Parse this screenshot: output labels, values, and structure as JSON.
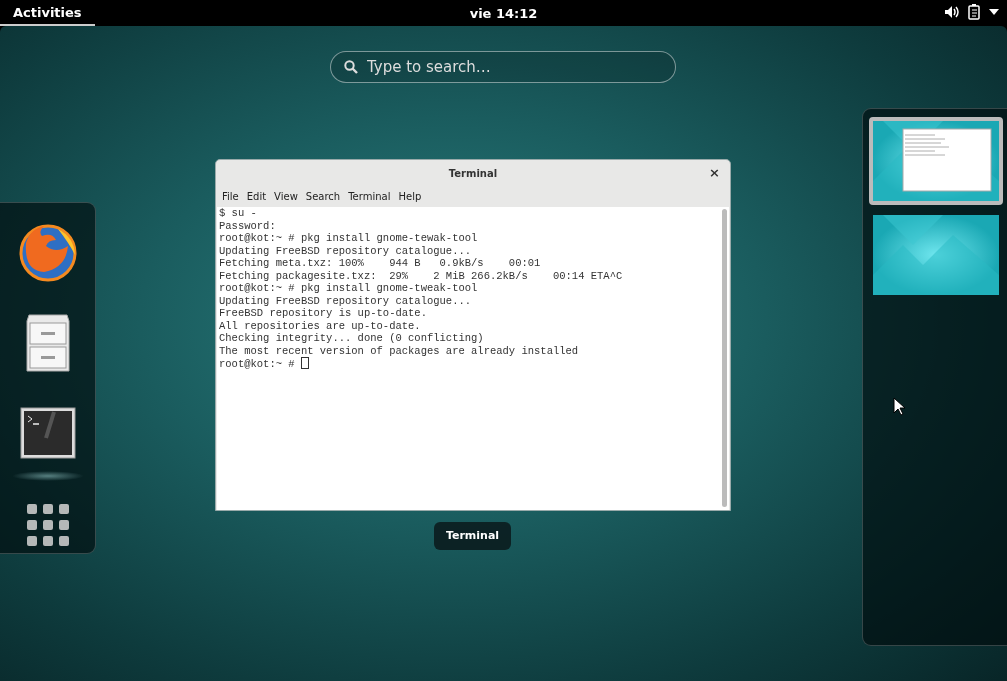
{
  "top_bar": {
    "activities": "Activities",
    "clock": "vie 14:12"
  },
  "search": {
    "placeholder": "Type to search…"
  },
  "dock": {
    "items": [
      {
        "kind": "browser",
        "running": false
      },
      {
        "kind": "files",
        "running": false
      },
      {
        "kind": "terminal",
        "running": true
      },
      {
        "kind": "app-grid"
      }
    ]
  },
  "window": {
    "title": "Terminal",
    "close": "×",
    "menu": [
      "File",
      "Edit",
      "View",
      "Search",
      "Terminal",
      "Help"
    ],
    "lines": [
      "$ su -",
      "Password:",
      "root@kot:~ # pkg install gnome-tewak-tool",
      "Updating FreeBSD repository catalogue...",
      "Fetching meta.txz: 100%    944 B   0.9kB/s    00:01",
      "Fetching packagesite.txz:  29%    2 MiB 266.2kB/s    00:14 ETA^C",
      "root@kot:~ # pkg install gnome-tweak-tool",
      "Updating FreeBSD repository catalogue...",
      "FreeBSD repository is up-to-date.",
      "All repositories are up-to-date.",
      "Checking integrity... done (0 conflicting)",
      "The most recent version of packages are already installed",
      "root@kot:~ # "
    ],
    "cursor": true
  },
  "window_caption": "Terminal",
  "workspaces": [
    {
      "selected": true,
      "has_window": true
    },
    {
      "selected": false,
      "has_window": false
    }
  ]
}
